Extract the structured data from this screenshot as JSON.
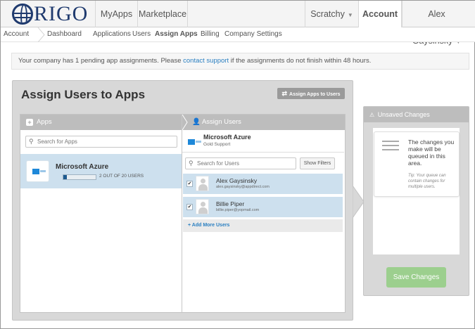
{
  "logo": {
    "text": "RIGO"
  },
  "topnav": {
    "myapps": "MyApps",
    "marketplace": "Marketplace",
    "company": "Scratchy",
    "account": "Account",
    "user": "Alex Gaysinsky"
  },
  "subnav": {
    "account": "Account",
    "dashboard": "Dashboard",
    "applications": "Applications",
    "users": "Users",
    "assign_apps": "Assign Apps",
    "billing": "Billing",
    "company_settings": "Company Settings"
  },
  "notice": {
    "before": "Your company has 1 pending app assignments. Please ",
    "link": "contact support",
    "after": " if the assignments do not finish within 48 hours."
  },
  "main": {
    "title": "Assign Users to Apps",
    "switch_button": "Assign Apps to Users"
  },
  "apps_column": {
    "heading": "Apps",
    "search_placeholder": "Search for Apps",
    "app": {
      "name": "Microsoft Azure",
      "user_count": "2 OUT OF 20 USERS",
      "usage_fraction": 0.1
    }
  },
  "users_column": {
    "heading": "Assign Users",
    "app_name": "Microsoft Azure",
    "app_plan": "Gold Support",
    "search_placeholder": "Search for Users",
    "filters_button": "Show Filters",
    "users": [
      {
        "name": "Alex Gaysinsky",
        "email": "alex.gaysinsky@appdirect.com",
        "checked": true
      },
      {
        "name": "Billie Piper",
        "email": "billie.piper@yopmail.com",
        "checked": true
      }
    ],
    "add_more": "+ Add More Users"
  },
  "unsaved": {
    "heading": "Unsaved Changes",
    "info": "The changes you make will be queued in this area.",
    "tip": "Tip: Your queue can contain changes for multiple users.",
    "save_button": "Save Changes"
  },
  "colors": {
    "brand": "#1f3a6e",
    "selection": "#cde0ee",
    "link": "#2a7fc1",
    "save": "#9ccf8e",
    "panel": "#d8d8d8"
  }
}
